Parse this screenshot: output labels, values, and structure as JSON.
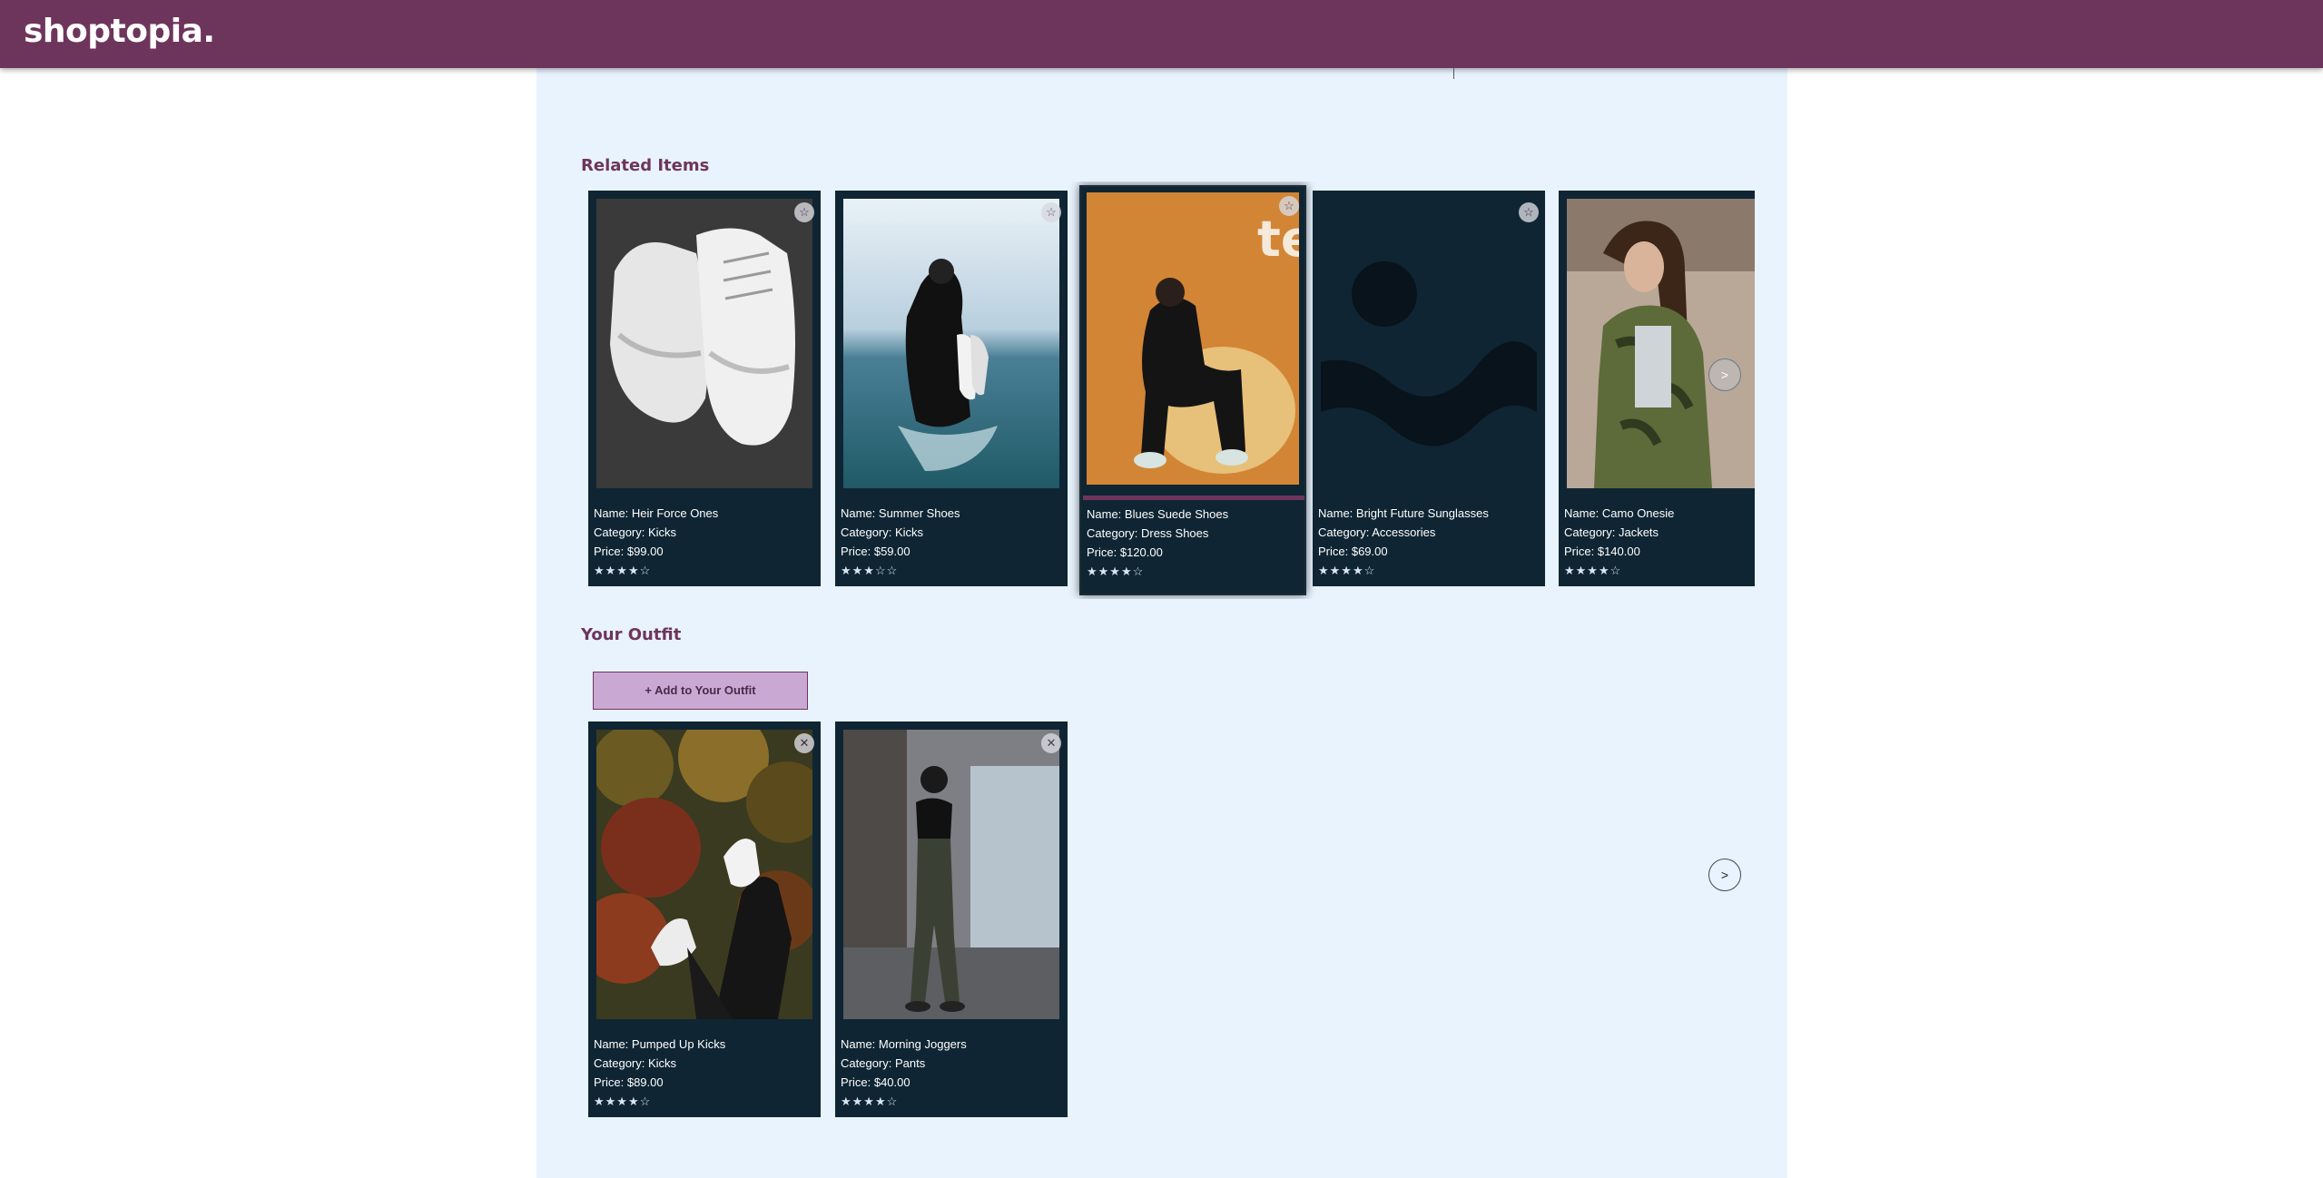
{
  "header": {
    "logo": "shoptopia."
  },
  "related": {
    "title": "Related Items",
    "cards": [
      {
        "name": "Name: Heir Force Ones",
        "category": "Category: Kicks",
        "price": "Price: $99.00",
        "stars": "★★★★☆",
        "rating": 3.5,
        "action_icon": "star-icon"
      },
      {
        "name": "Name: Summer Shoes",
        "category": "Category: Kicks",
        "price": "Price: $59.00",
        "stars": "★★★☆☆",
        "rating": 3,
        "action_icon": "star-icon"
      },
      {
        "name": "Name: Blues Suede Shoes",
        "category": "Category: Dress Shoes",
        "price": "Price: $120.00",
        "stars": "★★★★☆",
        "rating": 3.5,
        "action_icon": "star-icon"
      },
      {
        "name": "Name: Bright Future Sunglasses",
        "category": "Category: Accessories",
        "price": "Price: $69.00",
        "stars": "★★★★☆",
        "rating": 4,
        "action_icon": "star-icon"
      },
      {
        "name": "Name: Camo Onesie",
        "category": "Category: Jackets",
        "price": "Price: $140.00",
        "stars": "★★★★☆",
        "rating": 3.5,
        "action_icon": "star-icon"
      }
    ],
    "next_label": ">"
  },
  "outfit": {
    "title": "Your Outfit",
    "add_button": "+ Add to Your Outfit",
    "cards": [
      {
        "name": "Name: Pumped Up Kicks",
        "category": "Category: Kicks",
        "price": "Price: $89.00",
        "stars": "★★★★☆",
        "rating": 3.5,
        "action_icon": "close-icon"
      },
      {
        "name": "Name: Morning Joggers",
        "category": "Category: Pants",
        "price": "Price: $40.00",
        "stars": "★★★★☆",
        "rating": 3.5,
        "action_icon": "close-icon"
      }
    ],
    "next_label": ">"
  },
  "icons": {
    "star": "☆",
    "close": "✕"
  },
  "colors": {
    "brand": "#6e355c",
    "card_bg": "#0f2533",
    "page_bg": "#e8f3fe",
    "add_button_bg": "#c9a9d3"
  }
}
